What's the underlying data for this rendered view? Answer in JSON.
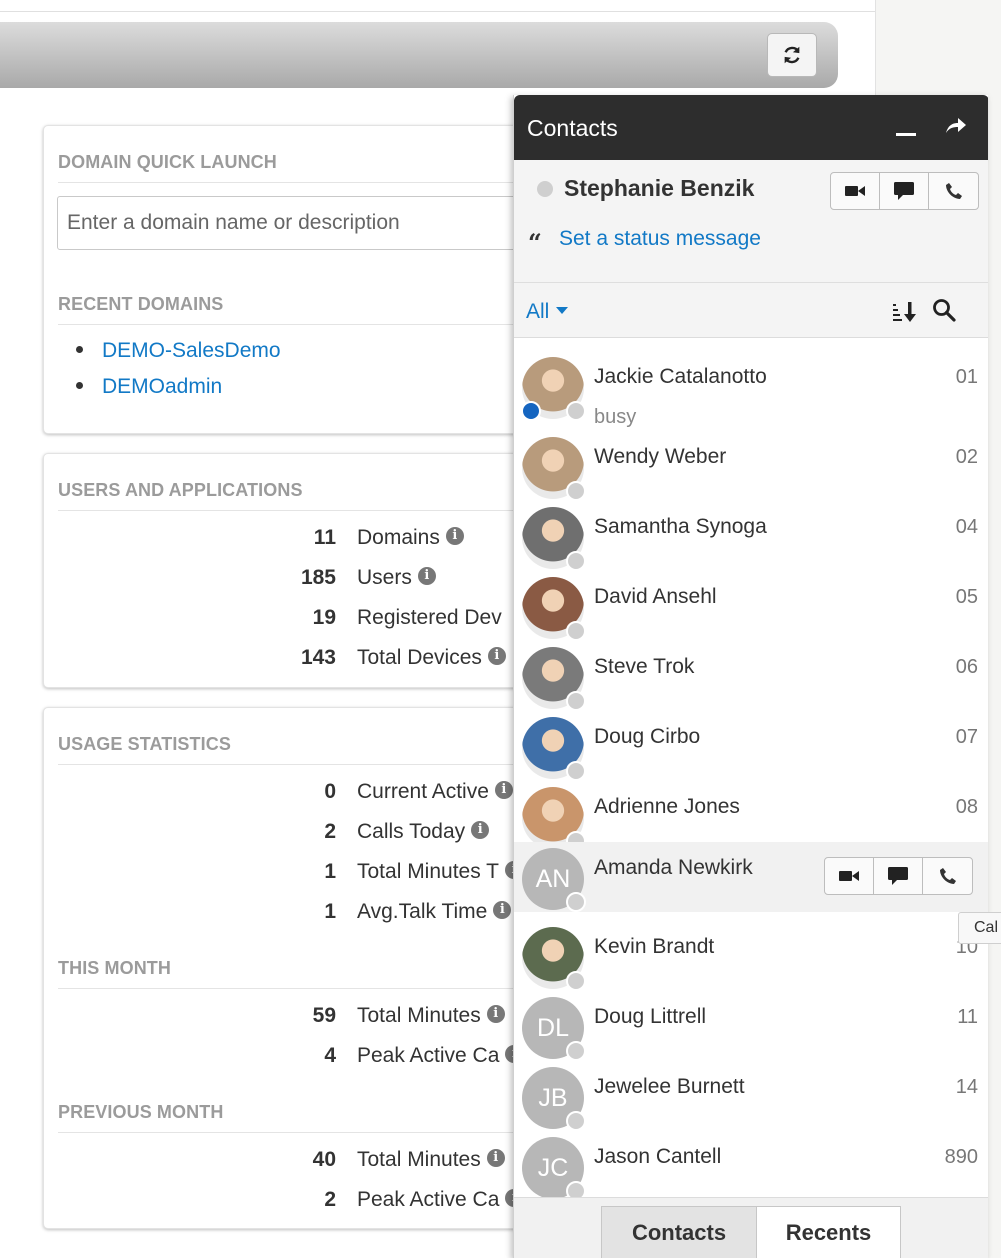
{
  "toolbar": {
    "refresh_icon": "refresh-icon"
  },
  "quick_launch": {
    "title": "DOMAIN QUICK LAUNCH",
    "placeholder": "Enter a domain name or description",
    "recent_title": "RECENT DOMAINS",
    "recent": [
      "DEMO-SalesDemo",
      "DEMOadmin"
    ]
  },
  "users_apps": {
    "title": "USERS AND APPLICATIONS",
    "stats": [
      {
        "value": "11",
        "label": "Domains",
        "info": true
      },
      {
        "value": "185",
        "label": "Users",
        "info": true
      },
      {
        "value": "19",
        "label": "Registered Dev",
        "info": false
      },
      {
        "value": "143",
        "label": "Total Devices",
        "info": true
      }
    ]
  },
  "usage": {
    "title": "USAGE STATISTICS",
    "stats": [
      {
        "value": "0",
        "label": "Current Active"
      },
      {
        "value": "2",
        "label": "Calls Today"
      },
      {
        "value": "1",
        "label": "Total Minutes T"
      },
      {
        "value": "1",
        "label": "Avg.Talk Time"
      }
    ],
    "this_month_title": "THIS MONTH",
    "this_month": [
      {
        "value": "59",
        "label": "Total Minutes"
      },
      {
        "value": "4",
        "label": "Peak Active Ca"
      }
    ],
    "prev_month_title": "PREVIOUS MONTH",
    "prev_month": [
      {
        "value": "40",
        "label": "Total Minutes"
      },
      {
        "value": "2",
        "label": "Peak Active Ca"
      }
    ]
  },
  "contacts_panel": {
    "title": "Contacts",
    "me": {
      "name": "Stephanie Benzik",
      "status_link": "Set a status message"
    },
    "filter": "All",
    "contacts": [
      {
        "name": "Jackie Catalanotto",
        "ext": "01",
        "status": "busy",
        "initials": "",
        "photo_color": "#b89b7c"
      },
      {
        "name": "Wendy Weber",
        "ext": "02",
        "status": "",
        "initials": "",
        "photo_color": "#b89b7c"
      },
      {
        "name": "Samantha Synoga",
        "ext": "04",
        "status": "",
        "initials": "",
        "photo_color": "#6f6f6f"
      },
      {
        "name": "David Ansehl",
        "ext": "05",
        "status": "",
        "initials": "",
        "photo_color": "#8a5a44"
      },
      {
        "name": "Steve Trok",
        "ext": "06",
        "status": "",
        "initials": "",
        "photo_color": "#7a7a7a"
      },
      {
        "name": "Doug Cirbo",
        "ext": "07",
        "status": "",
        "initials": "",
        "photo_color": "#3f6fa8"
      },
      {
        "name": "Adrienne Jones",
        "ext": "08",
        "status": "",
        "initials": "",
        "photo_color": "#c9956b"
      },
      {
        "name": "Amanda Newkirk",
        "ext": "",
        "status": "",
        "initials": "AN",
        "photo_color": ""
      },
      {
        "name": "Kevin Brandt",
        "ext": "10",
        "status": "",
        "initials": "",
        "photo_color": "#5c6b4f"
      },
      {
        "name": "Doug Littrell",
        "ext": "11",
        "status": "",
        "initials": "DL",
        "photo_color": ""
      },
      {
        "name": "Jewelee Burnett",
        "ext": "14",
        "status": "",
        "initials": "JB",
        "photo_color": ""
      },
      {
        "name": "Jason Cantell",
        "ext": "890",
        "status": "",
        "initials": "JC",
        "photo_color": ""
      }
    ],
    "tooltip": "Cal",
    "tabs": [
      "Contacts",
      "Recents"
    ]
  }
}
